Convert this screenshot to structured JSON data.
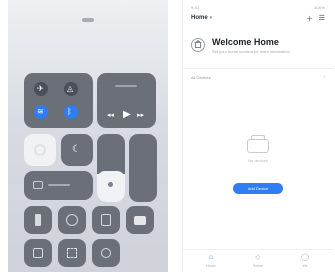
{
  "control_center": {
    "grabber_icon": "grabber-icon",
    "connectivity": [
      "airplane-mode-icon",
      "cellular-data-icon",
      "wifi-icon",
      "bluetooth-icon"
    ],
    "media": [
      "previous-track-icon",
      "play-icon",
      "next-track-icon"
    ],
    "toggles": [
      "orientation-lock-icon",
      "do-not-disturb-icon"
    ],
    "sliders": [
      "brightness-slider",
      "volume-slider"
    ],
    "shortcuts": [
      "flashlight-icon",
      "timer-icon",
      "calculator-icon",
      "camera-icon",
      "remote-icon",
      "qr-scanner-icon",
      "screen-record-icon"
    ],
    "accent_blue": "#2e7cf6"
  },
  "app": {
    "status_time": "9:41",
    "status_right": "100%",
    "home_label": "Home",
    "welcome_title": "Welcome Home",
    "welcome_subtitle": "Set your home location for more information",
    "section_label": "All Devices",
    "empty_text": "No devices",
    "add_button": "Add Device",
    "tabs": [
      {
        "label": "Home",
        "icon": "home-icon"
      },
      {
        "label": "Scene",
        "icon": "scene-icon"
      },
      {
        "label": "Me",
        "icon": "profile-icon"
      }
    ],
    "accent_blue": "#2f7ef5"
  }
}
